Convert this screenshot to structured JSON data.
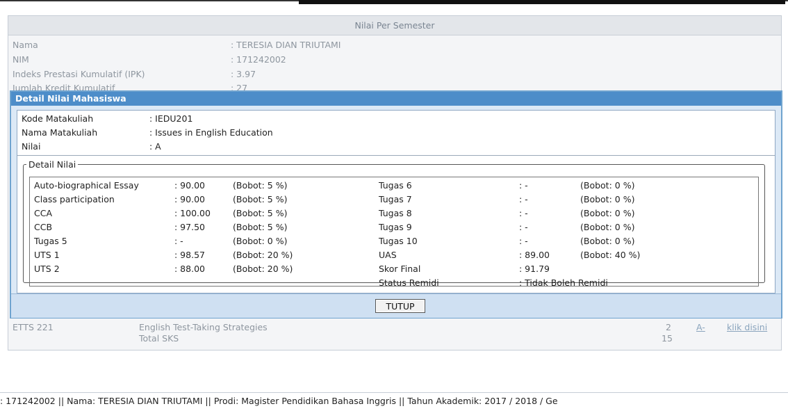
{
  "background": {
    "title": "Nilai Per Semester",
    "fields": [
      {
        "label": "Nama",
        "value": ": TERESIA DIAN TRIUTAMI"
      },
      {
        "label": "NIM",
        "value": ": 171242002"
      },
      {
        "label": "Indeks Prestasi Kumulatif (IPK)",
        "value": ": 3.97"
      },
      {
        "label": "Jumlah Kredit Kumulatif",
        "value": ": 27"
      }
    ],
    "course_row": {
      "code": "ETTS 221",
      "name": "English Test-Taking Strategies",
      "sks": "2",
      "grade": "A-",
      "link": "klik disini"
    },
    "total": {
      "label": "Total SKS",
      "value": "15"
    }
  },
  "modal": {
    "title": "Detail Nilai Mahasiswa",
    "info": [
      {
        "label": "Kode Matakuliah",
        "value": ": IEDU201"
      },
      {
        "label": "Nama Matakuliah",
        "value": ": Issues in English Education"
      },
      {
        "label": "Nilai",
        "value": ": A"
      }
    ],
    "legend": "Detail Nilai",
    "left_items": [
      {
        "label": "Auto-biographical Essay",
        "value": ": 90.00",
        "bobot": "(Bobot: 5 %)"
      },
      {
        "label": "Class participation",
        "value": ": 90.00",
        "bobot": "(Bobot: 5 %)"
      },
      {
        "label": "CCA",
        "value": ": 100.00",
        "bobot": "(Bobot: 5 %)"
      },
      {
        "label": "CCB",
        "value": ": 97.50",
        "bobot": "(Bobot: 5 %)"
      },
      {
        "label": "Tugas 5",
        "value": ": -",
        "bobot": "(Bobot: 0 %)"
      },
      {
        "label": "UTS 1",
        "value": ": 98.57",
        "bobot": "(Bobot: 20 %)"
      },
      {
        "label": "UTS 2",
        "value": ": 88.00",
        "bobot": "(Bobot: 20 %)"
      }
    ],
    "right_items": [
      {
        "label": "Tugas 6",
        "value": ": -",
        "bobot": "(Bobot: 0 %)"
      },
      {
        "label": "Tugas 7",
        "value": ": -",
        "bobot": "(Bobot: 0 %)"
      },
      {
        "label": "Tugas 8",
        "value": ": -",
        "bobot": "(Bobot: 0 %)"
      },
      {
        "label": "Tugas 9",
        "value": ": -",
        "bobot": "(Bobot: 0 %)"
      },
      {
        "label": "Tugas 10",
        "value": ": -",
        "bobot": "(Bobot: 0 %)"
      },
      {
        "label": "UAS",
        "value": ": 89.00",
        "bobot": "(Bobot: 40 %)"
      },
      {
        "label": "Skor Final",
        "value": ": 91.79",
        "bobot": ""
      },
      {
        "label": "Status Remidi",
        "value": ": Tidak Boleh Remidi",
        "bobot": ""
      }
    ],
    "close_button": "TUTUP"
  },
  "status_bar": ": 171242002 || Nama: TERESIA DIAN TRIUTAMI || Prodi: Magister Pendidikan Bahasa Inggris || Tahun Akademik: 2017 / 2018 / Ge"
}
